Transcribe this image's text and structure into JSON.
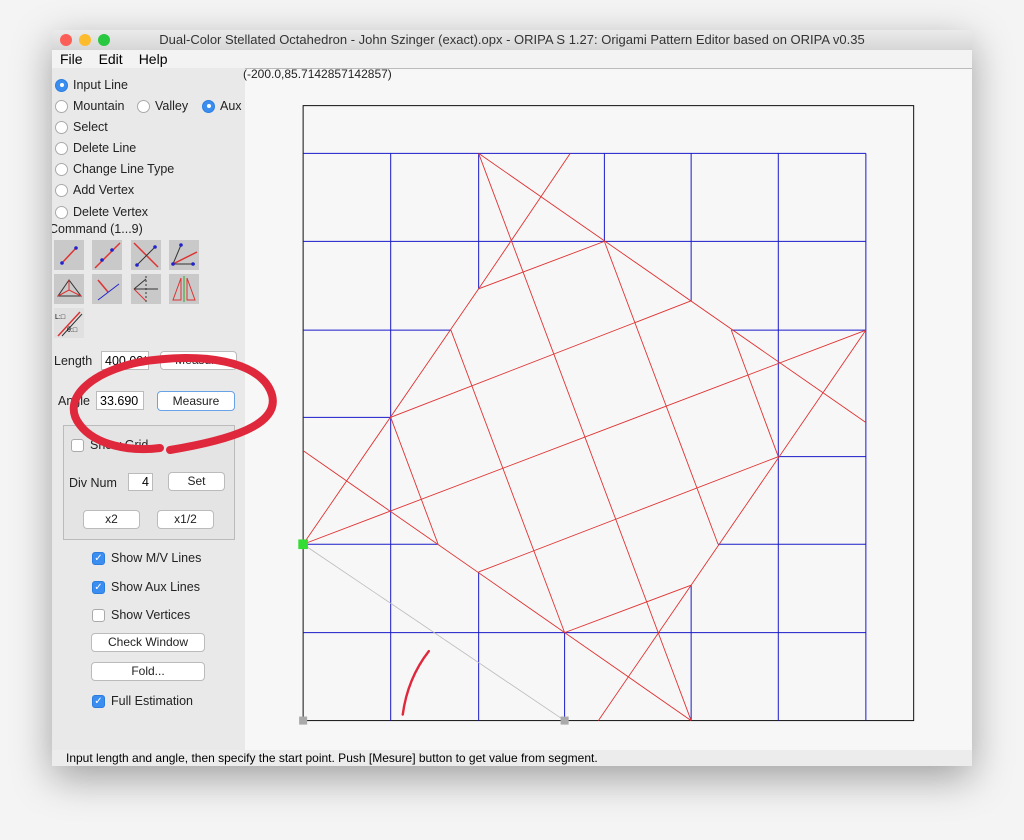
{
  "window": {
    "title": "Dual-Color Stellated Octahedron - John Szinger (exact).opx - ORIPA S 1.27: Origami Pattern Editor based on ORIPA  v0.35"
  },
  "menu": [
    "File",
    "Edit",
    "Help"
  ],
  "coords": "(-200.0,85.7142857142857)",
  "modes": {
    "input_line": "Input Line",
    "mountain": "Mountain",
    "valley": "Valley",
    "aux": "Aux",
    "select": "Select",
    "delete_line": "Delete Line",
    "change_line_type": "Change Line Type",
    "add_vertex": "Add Vertex",
    "delete_vertex": "Delete Vertex"
  },
  "selected": {
    "mode": "Input Line",
    "line_type": "Aux"
  },
  "command_label": "Command (1...9)",
  "commands": [
    "segment-by-two-points",
    "line-by-two-points",
    "perpendicular-bisector",
    "angle-bisector",
    "triangle-incenter",
    "perpendicular-line",
    "symmetric-line",
    "mirror-copy",
    "length-angle-input"
  ],
  "length": {
    "label": "Length",
    "value": "400.000",
    "button": "Measure"
  },
  "angle": {
    "label": "Angle",
    "value": "33.690",
    "button": "Measure"
  },
  "grid": {
    "show_label": "Show Grid",
    "show": false,
    "div_label": "Div Num",
    "div_value": "4",
    "set": "Set",
    "x2": "x2",
    "half": "x1/2"
  },
  "options": {
    "mv": "Show M/V Lines",
    "aux": "Show Aux Lines",
    "vertices": "Show Vertices",
    "check": "Check Window",
    "fold": "Fold...",
    "full": "Full Estimation"
  },
  "option_states": {
    "mv": true,
    "aux": true,
    "vertices": false,
    "full": true
  },
  "status": "Input length and angle, then specify the start point. Push [Mesure] button to get value from segment.",
  "colors": {
    "mountain": "#e03030",
    "aux": "#1a1ac8",
    "accent": "#3b8ef0",
    "annotation": "#e0283c"
  }
}
